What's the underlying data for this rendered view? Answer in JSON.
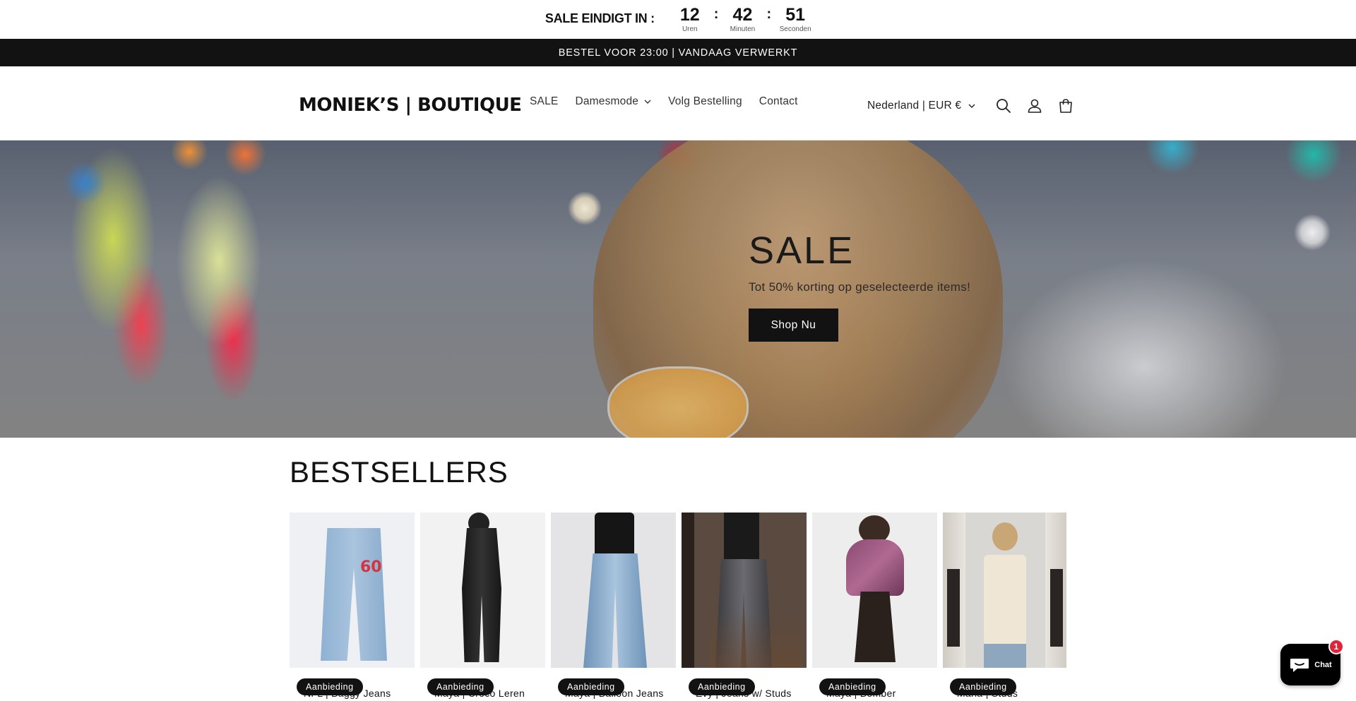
{
  "countdown": {
    "label": "SALE EINDIGT IN :",
    "hours": "12",
    "hours_label": "Uren",
    "minutes": "42",
    "minutes_label": "Minuten",
    "seconds": "51",
    "seconds_label": "Seconden",
    "separator": ":"
  },
  "announcement": "BESTEL VOOR 23:00 | VANDAAG VERWERKT",
  "header": {
    "logo": "MONIEK’S | BOUTIQUE",
    "nav": [
      "SALE",
      "Damesmode",
      "Volg Bestelling",
      "Contact"
    ],
    "country": "Nederland | EUR €",
    "icons": [
      "search-icon",
      "account-icon",
      "cart-icon"
    ]
  },
  "hero": {
    "title": "SALE",
    "subtitle": "Tot 50% korting op geselecteerde items!",
    "button": "Shop Nu"
  },
  "bestsellers": {
    "title": "BESTSELLERS",
    "products": [
      {
        "name": "NFL | Baggy Jeans",
        "badge": "Aanbieding"
      },
      {
        "name": "Maya | Croco Leren",
        "badge": "Aanbieding"
      },
      {
        "name": "Maya | Balloon Jeans",
        "badge": "Aanbieding"
      },
      {
        "name": "Evy | Jeans w/ Studs",
        "badge": "Aanbieding"
      },
      {
        "name": "Maya | Bomber",
        "badge": "Aanbieding"
      },
      {
        "name": "Maria | Studs",
        "badge": "Aanbieding"
      }
    ]
  },
  "chat": {
    "label": "Chat",
    "unread": "1"
  },
  "colors": {
    "primary": "#121212",
    "announcement_bg": "#121212",
    "chat_badge": "#e0243c"
  }
}
